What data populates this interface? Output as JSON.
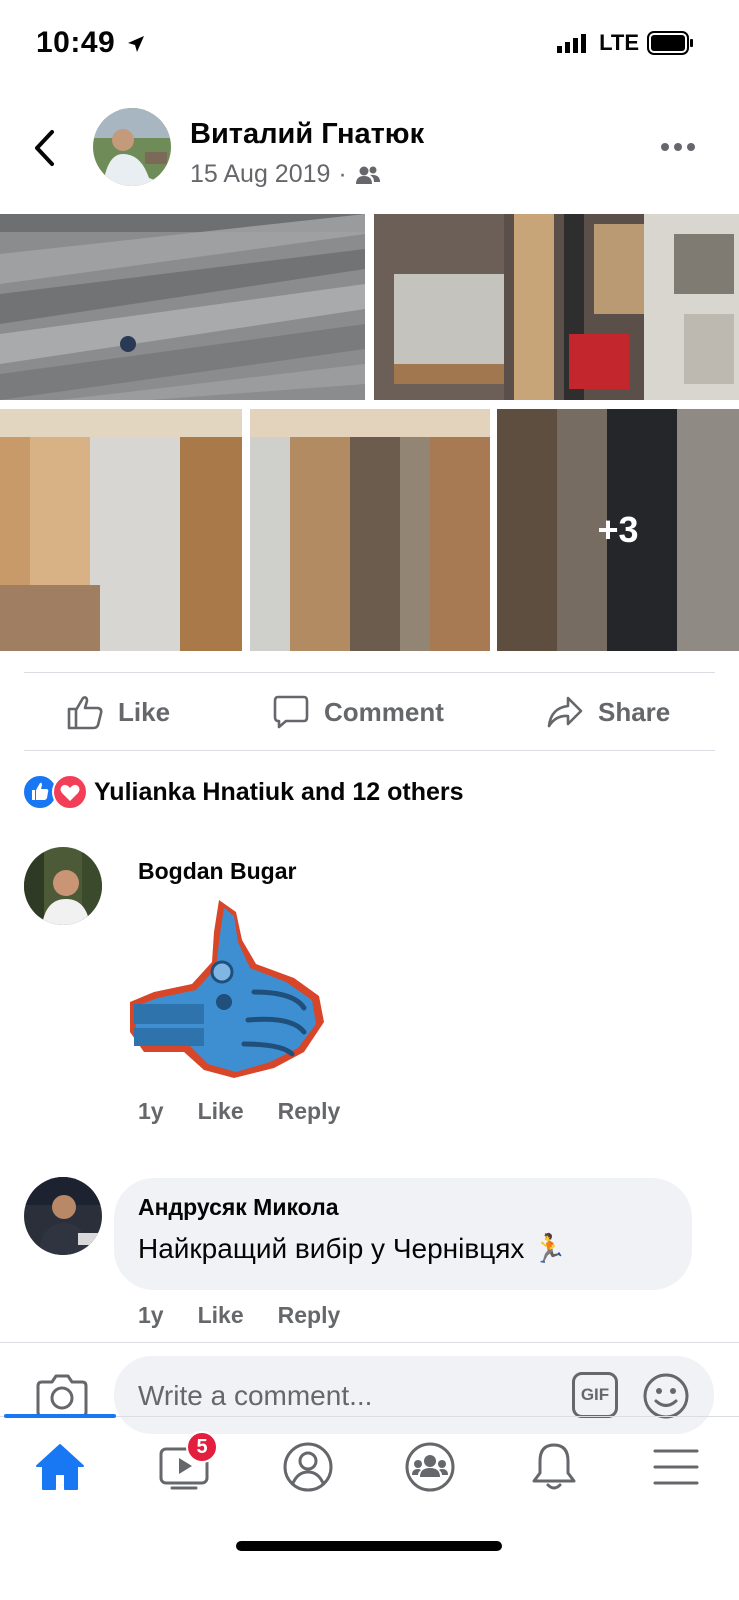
{
  "status_bar": {
    "time": "10:49",
    "network": "LTE"
  },
  "post": {
    "author": "Виталий Гнатюк",
    "date": "15 Aug 2019",
    "separator": "·",
    "photos_more": "+3"
  },
  "actions": {
    "like": "Like",
    "comment": "Comment",
    "share": "Share"
  },
  "reactions": {
    "summary": "Yulianka Hnatiuk and 12 others"
  },
  "comments": [
    {
      "author": "Bogdan Bugar",
      "text": "",
      "time": "1y",
      "like": "Like",
      "reply": "Reply"
    },
    {
      "author": "Андрусяк Микола",
      "text": "Найкращий вибір у Чернівцях 🏃",
      "time": "1y",
      "like": "Like",
      "reply": "Reply"
    }
  ],
  "composer": {
    "placeholder": "Write a comment...",
    "gif": "GIF"
  },
  "tabbar": {
    "watch_badge": "5"
  },
  "colors": {
    "accent": "#1877f2",
    "like_blue": "#1877f2",
    "love_red": "#f33e58",
    "badge_red": "#e41e3f"
  }
}
